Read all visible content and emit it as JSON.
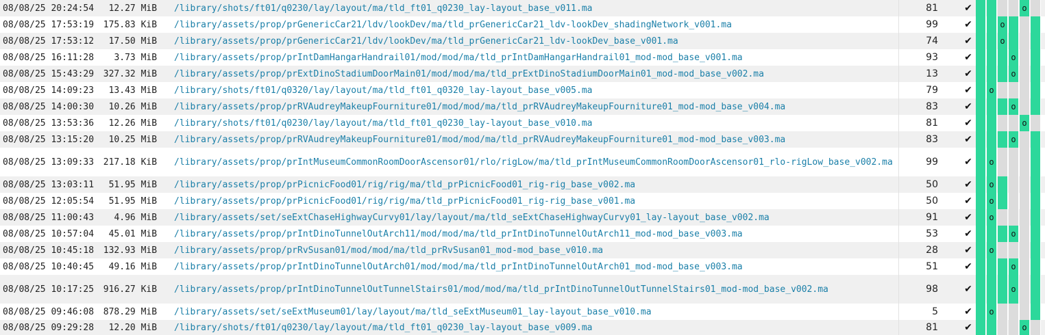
{
  "colors": {
    "green": "#2dd89b",
    "gray": "#dcdcdc",
    "link": "#1a7fa8"
  },
  "rows": [
    {
      "datetime": "08/08/25 20:24:54",
      "size": "12.27 MiB",
      "path": "/library/shots/ft01/q0230/lay/layout/ma/tld_ft01_q0230_lay-layout_base_v011.ma",
      "count": "81",
      "check": "✔",
      "cells": [
        "g",
        "g",
        "x",
        "x",
        "o",
        "x"
      ]
    },
    {
      "datetime": "08/08/25 17:53:19",
      "size": "175.83 KiB",
      "path": "/library/assets/prop/prGenericCar21/ldv/lookDev/ma/tld_prGenericCar21_ldv-lookDev_shadingNetwork_v001.ma",
      "count": "99",
      "check": "✔",
      "cells": [
        "g",
        "g",
        "o",
        "g",
        "x",
        "g"
      ]
    },
    {
      "datetime": "08/08/25 17:53:12",
      "size": "17.50 MiB",
      "path": "/library/assets/prop/prGenericCar21/ldv/lookDev/ma/tld_prGenericCar21_ldv-lookDev_base_v001.ma",
      "count": "74",
      "check": "✔",
      "cells": [
        "g",
        "g",
        "o",
        "g",
        "x",
        "g"
      ]
    },
    {
      "datetime": "08/08/25 16:11:28",
      "size": "3.73 MiB",
      "path": "/library/assets/prop/prIntDamHangarHandrail01/mod/mod/ma/tld_prIntDamHangarHandrail01_mod-mod_base_v001.ma",
      "count": "93",
      "check": "✔",
      "cells": [
        "g",
        "g",
        "g",
        "o",
        "x",
        "g"
      ]
    },
    {
      "datetime": "08/08/25 15:43:29",
      "size": "327.32 MiB",
      "path": "/library/assets/prop/prExtDinoStadiumDoorMain01/mod/mod/ma/tld_prExtDinoStadiumDoorMain01_mod-mod_base_v002.ma",
      "count": "13",
      "check": "✔",
      "cells": [
        "g",
        "g",
        "g",
        "o",
        "x",
        "g"
      ]
    },
    {
      "datetime": "08/08/25 14:09:23",
      "size": "13.43 MiB",
      "path": "/library/shots/ft01/q0320/lay/layout/ma/tld_ft01_q0320_lay-layout_base_v005.ma",
      "count": "79",
      "check": "✔",
      "cells": [
        "g",
        "o",
        "x",
        "x",
        "x",
        "g"
      ]
    },
    {
      "datetime": "08/08/25 14:00:30",
      "size": "10.26 MiB",
      "path": "/library/assets/prop/prRVAudreyMakeupFourniture01/mod/mod/ma/tld_prRVAudreyMakeupFourniture01_mod-mod_base_v004.ma",
      "count": "83",
      "check": "✔",
      "cells": [
        "g",
        "g",
        "g",
        "o",
        "x",
        "g"
      ]
    },
    {
      "datetime": "08/08/25 13:53:36",
      "size": "12.26 MiB",
      "path": "/library/shots/ft01/q0230/lay/layout/ma/tld_ft01_q0230_lay-layout_base_v010.ma",
      "count": "81",
      "check": "✔",
      "cells": [
        "g",
        "g",
        "x",
        "x",
        "o",
        "x"
      ]
    },
    {
      "datetime": "08/08/25 13:15:20",
      "size": "10.25 MiB",
      "path": "/library/assets/prop/prRVAudreyMakeupFourniture01/mod/mod/ma/tld_prRVAudreyMakeupFourniture01_mod-mod_base_v003.ma",
      "count": "83",
      "check": "✔",
      "cells": [
        "g",
        "g",
        "g",
        "o",
        "x",
        "g"
      ]
    },
    {
      "datetime": "08/08/25 13:09:33",
      "size": "217.18 KiB",
      "path": "/library/assets/prop/prIntMuseumCommonRoomDoorAscensor01/rlo/rigLow/ma/tld_prIntMuseumCommonRoomDoorAscensor01_rlo-rigLow_base_v002.ma",
      "count": "99",
      "check": "✔",
      "cells": [
        "g",
        "o",
        "x",
        "x",
        "x",
        "g"
      ]
    },
    {
      "datetime": "08/08/25 13:03:11",
      "size": "51.95 MiB",
      "path": "/library/assets/prop/prPicnicFood01/rig/rig/ma/tld_prPicnicFood01_rig-rig_base_v002.ma",
      "count": "50",
      "check": "✔",
      "cells": [
        "g",
        "o",
        "g",
        "x",
        "x",
        "g"
      ]
    },
    {
      "datetime": "08/08/25 12:05:54",
      "size": "51.95 MiB",
      "path": "/library/assets/prop/prPicnicFood01/rig/rig/ma/tld_prPicnicFood01_rig-rig_base_v001.ma",
      "count": "50",
      "check": "✔",
      "cells": [
        "g",
        "o",
        "g",
        "x",
        "x",
        "g"
      ]
    },
    {
      "datetime": "08/08/25 11:00:43",
      "size": "4.96 MiB",
      "path": "/library/assets/set/seExtChaseHighwayCurvy01/lay/layout/ma/tld_seExtChaseHighwayCurvy01_lay-layout_base_v002.ma",
      "count": "91",
      "check": "✔",
      "cells": [
        "g",
        "o",
        "x",
        "x",
        "x",
        "g"
      ]
    },
    {
      "datetime": "08/08/25 10:57:04",
      "size": "45.01 MiB",
      "path": "/library/assets/prop/prIntDinoTunnelOutArch11/mod/mod/ma/tld_prIntDinoTunnelOutArch11_mod-mod_base_v003.ma",
      "count": "53",
      "check": "✔",
      "cells": [
        "g",
        "g",
        "g",
        "o",
        "x",
        "g"
      ]
    },
    {
      "datetime": "08/08/25 10:45:18",
      "size": "132.93 MiB",
      "path": "/library/assets/prop/prRvSusan01/mod/mod/ma/tld_prRvSusan01_mod-mod_base_v010.ma",
      "count": "28",
      "check": "✔",
      "cells": [
        "g",
        "o",
        "x",
        "x",
        "x",
        "g"
      ]
    },
    {
      "datetime": "08/08/25 10:40:45",
      "size": "49.16 MiB",
      "path": "/library/assets/prop/prIntDinoTunnelOutArch01/mod/mod/ma/tld_prIntDinoTunnelOutArch01_mod-mod_base_v003.ma",
      "count": "51",
      "check": "✔",
      "cells": [
        "g",
        "g",
        "g",
        "o",
        "x",
        "g"
      ]
    },
    {
      "datetime": "08/08/25 10:17:25",
      "size": "916.27 KiB",
      "path": "/library/assets/prop/prIntDinoTunnelOutTunnelStairs01/mod/mod/ma/tld_prIntDinoTunnelOutTunnelStairs01_mod-mod_base_v002.ma",
      "count": "98",
      "check": "✔",
      "cells": [
        "g",
        "g",
        "g",
        "o",
        "x",
        "g"
      ]
    },
    {
      "datetime": "08/08/25 09:46:08",
      "size": "878.29 MiB",
      "path": "/library/assets/set/seExtMuseum01/lay/layout/ma/tld_seExtMuseum01_lay-layout_base_v010.ma",
      "count": "5",
      "check": "✔",
      "cells": [
        "g",
        "o",
        "x",
        "x",
        "x",
        "g"
      ]
    },
    {
      "datetime": "08/08/25 09:29:28",
      "size": "12.20 MiB",
      "path": "/library/shots/ft01/q0230/lay/layout/ma/tld_ft01_q0230_lay-layout_base_v009.ma",
      "count": "81",
      "check": "✔",
      "cells": [
        "g",
        "g",
        "x",
        "x",
        "o",
        "x"
      ]
    }
  ]
}
